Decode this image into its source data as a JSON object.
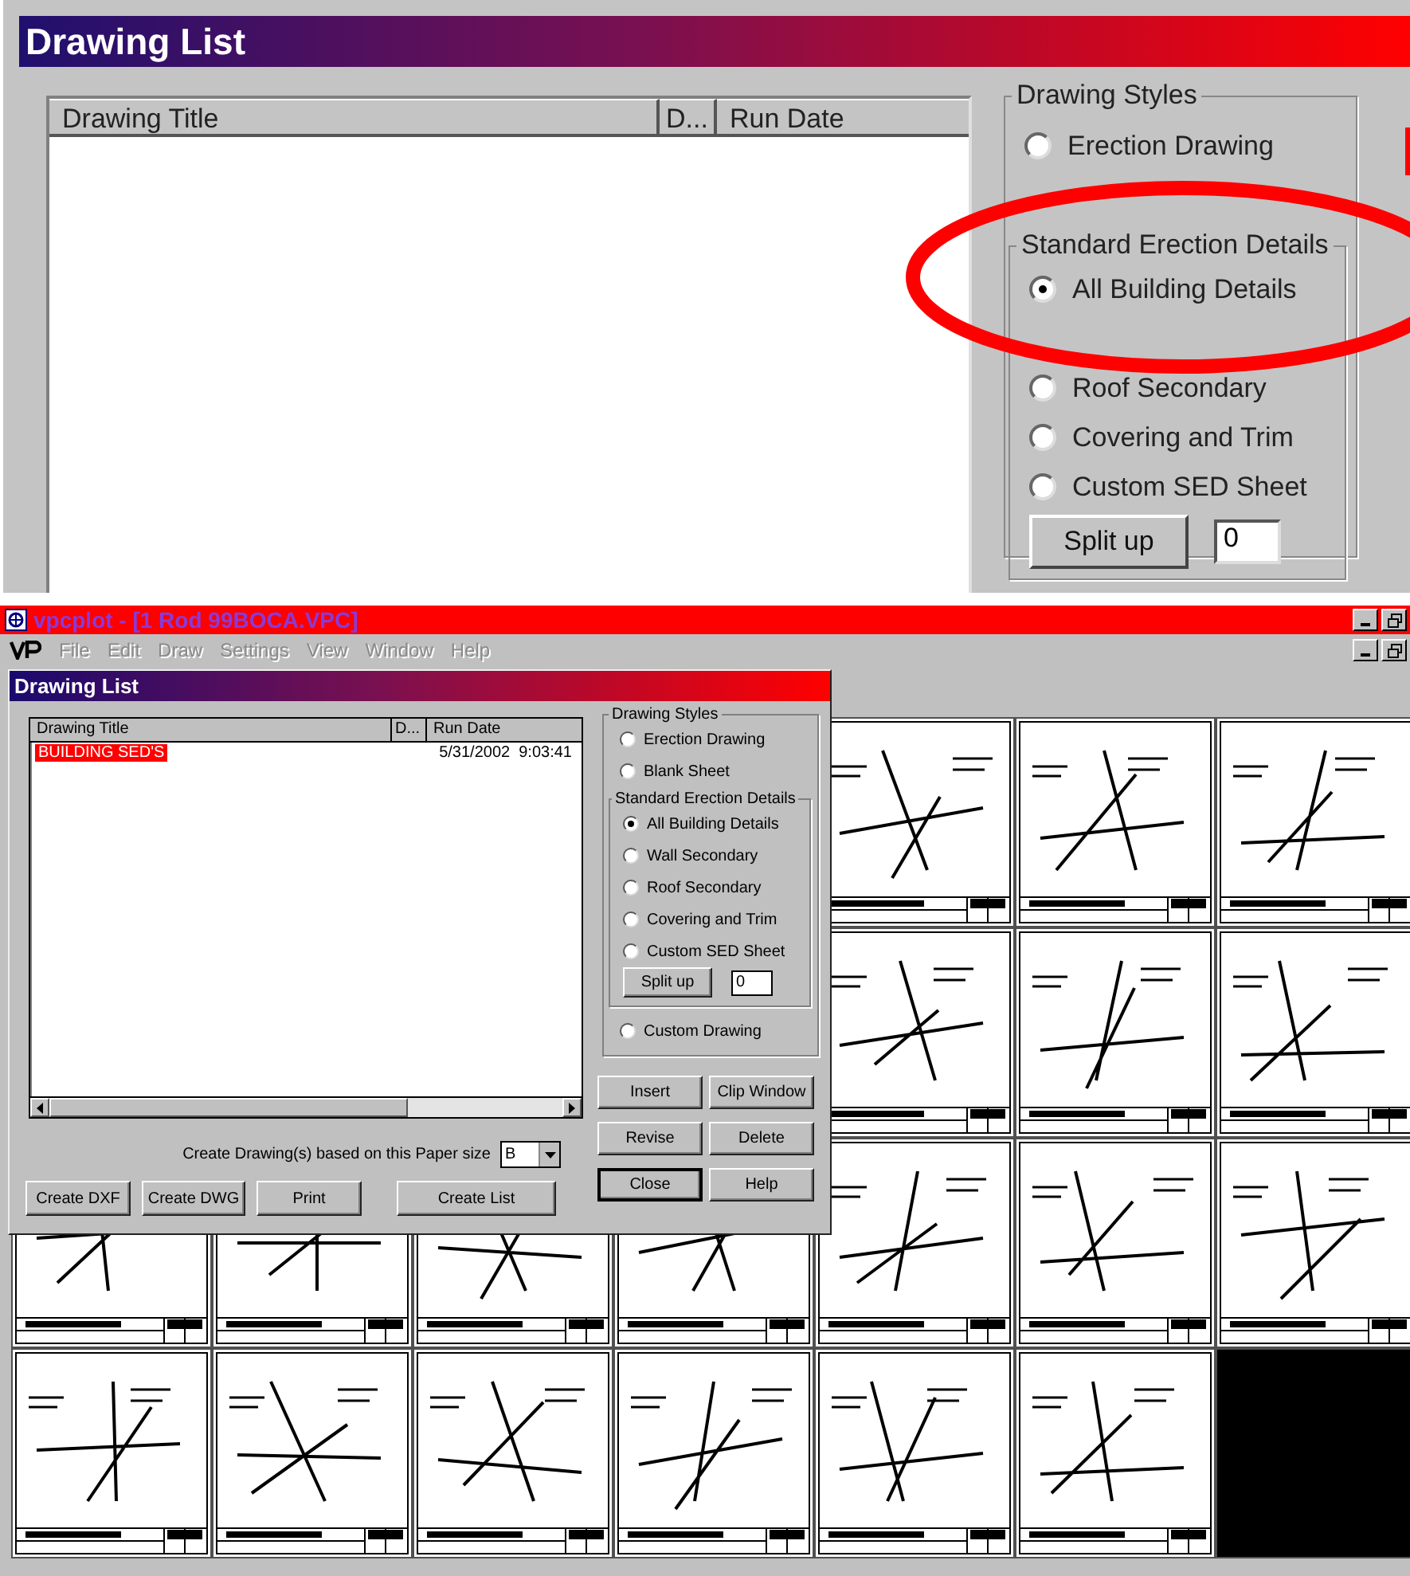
{
  "zoomed_dialog": {
    "title": "Drawing List",
    "columns": [
      "Drawing Title",
      "D...",
      "Run Date"
    ],
    "styles_group": {
      "title": "Drawing Styles",
      "options": [
        {
          "label": "Erection Drawing",
          "selected": false
        }
      ]
    },
    "sed_group": {
      "title": "Standard Erection Details",
      "options": [
        {
          "label": "All Building Details",
          "selected": true
        },
        {
          "label": "Roof Secondary",
          "selected": false
        },
        {
          "label": "Covering and Trim",
          "selected": false
        },
        {
          "label": "Custom SED Sheet",
          "selected": false
        }
      ]
    },
    "split_button": "Split up",
    "split_value": "0"
  },
  "app_window": {
    "title": "vpcplot - [1 Rod 99BOCA.VPC]",
    "menu": [
      {
        "label": "File",
        "disabled": true
      },
      {
        "label": "Edit",
        "disabled": true
      },
      {
        "label": "Draw",
        "disabled": true
      },
      {
        "label": "Settings",
        "disabled": true
      },
      {
        "label": "View",
        "disabled": true
      },
      {
        "label": "Window",
        "disabled": true
      },
      {
        "label": "Help",
        "disabled": true
      }
    ]
  },
  "dialog": {
    "title": "Drawing List",
    "columns": [
      "Drawing Title",
      "D...",
      "Run Date"
    ],
    "rows": [
      {
        "title": "BUILDING SED'S",
        "date": "5/31/2002  9:03:41",
        "selected": true
      }
    ],
    "styles_group": {
      "title": "Drawing Styles",
      "options": [
        {
          "label": "Erection Drawing",
          "selected": false
        },
        {
          "label": "Blank Sheet",
          "selected": false
        }
      ]
    },
    "sed_group": {
      "title": "Standard Erection Details",
      "options": [
        {
          "label": "All Building Details",
          "selected": true
        },
        {
          "label": "Wall Secondary",
          "selected": false
        },
        {
          "label": "Roof Secondary",
          "selected": false
        },
        {
          "label": "Covering and Trim",
          "selected": false
        },
        {
          "label": "Custom SED Sheet",
          "selected": false
        }
      ]
    },
    "split_button": "Split up",
    "split_value": "0",
    "custom_option": {
      "label": "Custom Drawing",
      "selected": false
    },
    "paper_label": "Create Drawing(s) based on this Paper size",
    "paper_value": "B",
    "bottom_buttons": [
      "Create DXF",
      "Create DWG",
      "Print",
      "Create List"
    ],
    "side_buttons": [
      {
        "label": "Insert",
        "default": false
      },
      {
        "label": "Clip Window",
        "default": false
      },
      {
        "label": "Revise",
        "default": false
      },
      {
        "label": "Delete",
        "default": false
      },
      {
        "label": "Close",
        "default": true
      },
      {
        "label": "Help",
        "default": false
      }
    ]
  }
}
